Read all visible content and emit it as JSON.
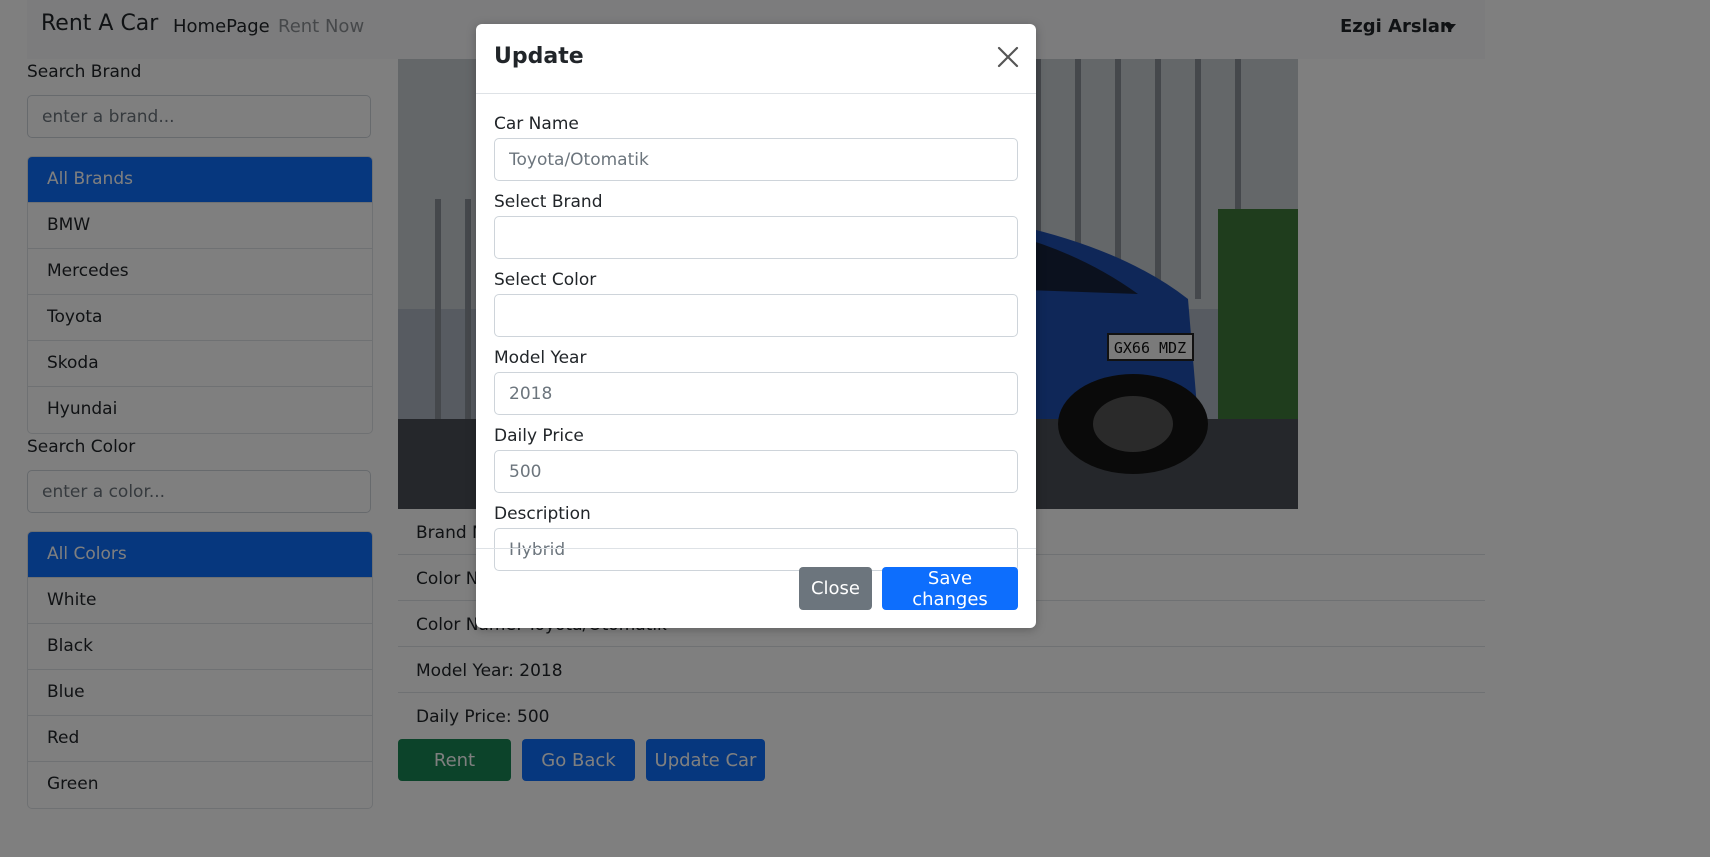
{
  "navbar": {
    "brand": "Rent A Car",
    "links": [
      "HomePage",
      "Rent Now"
    ],
    "user": "Ezgi Arslan"
  },
  "sidebar": {
    "brand_search": {
      "label": "Search Brand",
      "placeholder": "enter a brand..."
    },
    "brands": [
      "All Brands",
      "BMW",
      "Mercedes",
      "Toyota",
      "Skoda",
      "Hyundai"
    ],
    "color_search": {
      "label": "Search Color",
      "placeholder": "enter a color..."
    },
    "colors": [
      "All Colors",
      "White",
      "Black",
      "Blue",
      "Red",
      "Green"
    ]
  },
  "car": {
    "image_alt": "GX66 MDZ",
    "details": [
      "Brand Name: Toyota",
      "Color Name: Blue",
      "Color Name: Toyota/Otomatik",
      "Model Year: 2018",
      "Daily Price: 500"
    ],
    "buttons": {
      "rent": "Rent",
      "back": "Go Back",
      "update": "Update Car"
    }
  },
  "modal": {
    "title": "Update",
    "fields": [
      {
        "label": "Car Name",
        "placeholder": "Toyota/Otomatik"
      },
      {
        "label": "Select Brand",
        "placeholder": ""
      },
      {
        "label": "Select Color",
        "placeholder": ""
      },
      {
        "label": "Model Year",
        "placeholder": "2018"
      },
      {
        "label": "Daily Price",
        "placeholder": "500"
      },
      {
        "label": "Description",
        "placeholder": "Hybrid"
      }
    ],
    "close_label": "Close",
    "save_label": "Save changes"
  },
  "colors": {
    "primary": "#0d6efd",
    "success": "#198754",
    "secondary": "#6c757d"
  }
}
